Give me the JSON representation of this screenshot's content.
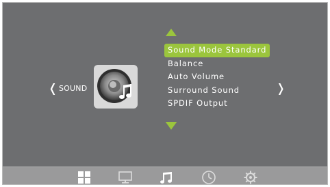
{
  "osd": {
    "section": "SOUND",
    "prev_glyph": "❬",
    "next_glyph": "❭",
    "menu_items": [
      "Sound Mode Standard",
      "Balance",
      "Auto Volume",
      "Surround Sound",
      "SPDIF Output"
    ],
    "selected_index": 0,
    "accent_color": "#9bc53d",
    "background_color": "#6d6e70"
  },
  "taskbar": {
    "icons": [
      "picture-grid-icon",
      "monitor-icon",
      "music-note-icon",
      "clock-icon",
      "gear-icon"
    ],
    "active_icon": "music-note-icon"
  }
}
